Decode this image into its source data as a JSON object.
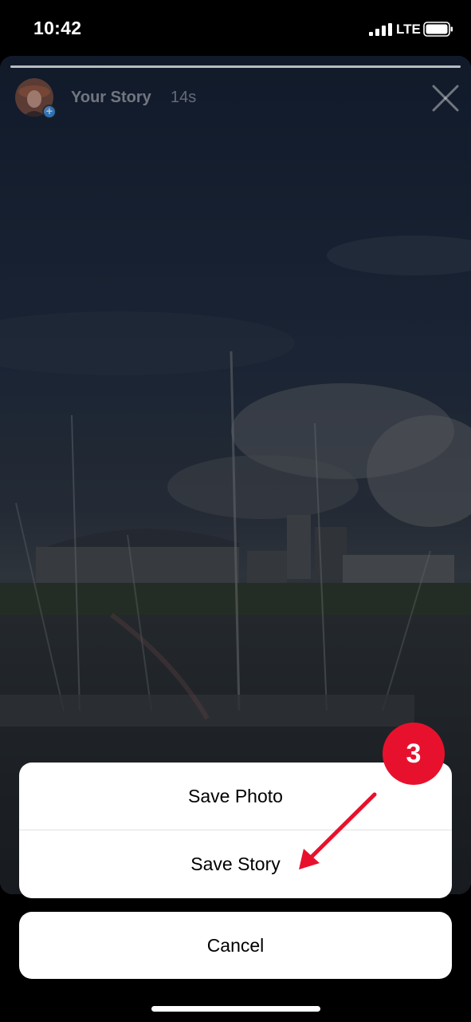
{
  "status_bar": {
    "time": "10:42",
    "network": "LTE",
    "icons": [
      "signal-icon",
      "battery-icon"
    ]
  },
  "story": {
    "title": "Your Story",
    "time_ago": "14s",
    "progress": 1.0,
    "icons": [
      "avatar",
      "add-story-icon",
      "close-icon"
    ]
  },
  "action_sheet": {
    "items": [
      {
        "label": "Save Photo"
      },
      {
        "label": "Save Story"
      }
    ],
    "cancel_label": "Cancel"
  },
  "annotation": {
    "step_number": "3",
    "color": "#e8112d"
  }
}
